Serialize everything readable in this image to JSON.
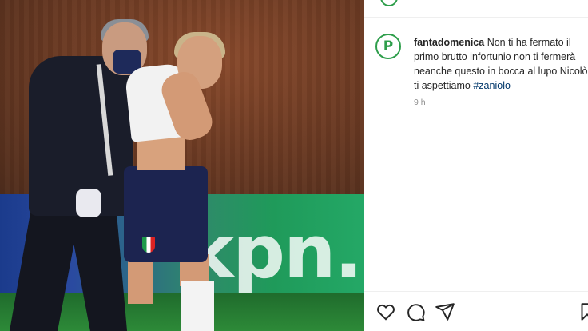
{
  "photo": {
    "ad_text": "kpn."
  },
  "post": {
    "username": "fantadomenica",
    "caption": "Non ti ha fermato il primo brutto infortunio non ti fermerà neanche questo in bocca al lupo Nicolò ti aspettiamo",
    "hashtag": "#zaniolo",
    "time_ago": "9 h"
  },
  "avatar": {
    "logo_letter": "P",
    "ring_color": "#2e9e4b"
  },
  "actions": {
    "icons": [
      "heart-icon",
      "comment-icon",
      "share-icon",
      "bookmark-icon"
    ]
  }
}
